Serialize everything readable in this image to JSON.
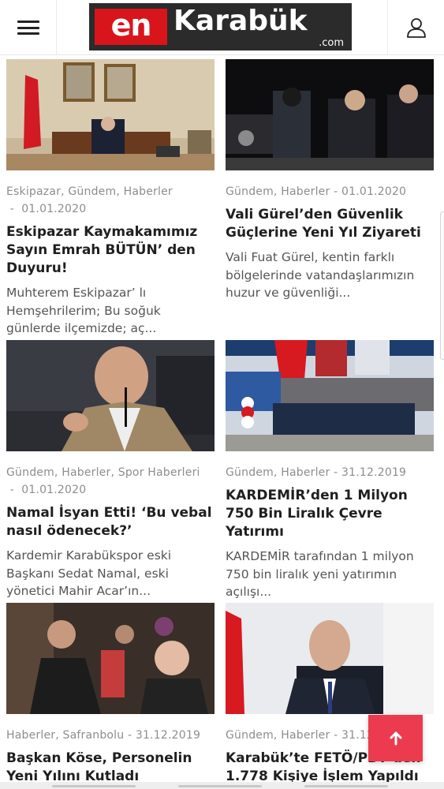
{
  "header": {
    "logo_en": "en",
    "logo_name": "Karabük",
    "logo_domain": ".com",
    "menu_icon": "hamburger-menu-icon",
    "user_icon": "user-account-icon"
  },
  "colors": {
    "brand_red": "#d8151b",
    "logo_bg": "#2b2b2b",
    "scroll_top_bg": "#ec3b4f"
  },
  "articles": [
    {
      "meta_line1": "Eskipazar, Gündem, Haberler",
      "meta_line2": " -  01.01.2020",
      "title": "Eskipazar Kaymakamımız Sayın Emrah BÜTÜN’ den Duyuru!",
      "excerpt": "Muhterem Eskipazar’ lı Hemşehrilerim;   Bu soğuk günlerde ilçemizde; aç..."
    },
    {
      "meta_line1": "Gündem, Haberler -  01.01.2020",
      "meta_line2": "",
      "title": "Vali Gürel’den Güvenlik Güçlerine Yeni Yıl Ziyareti",
      "excerpt": "Vali Fuat Gürel, kentin farklı bölgelerinde vatandaşlarımızın huzur ve güvenliği..."
    },
    {
      "meta_line1": "Gündem, Haberler, Spor Haberleri",
      "meta_line2": " -  01.01.2020",
      "title": "Namal İsyan Etti! ‘Bu vebal nasıl ödenecek?’",
      "excerpt": "Kardemir Karabükspor eski Başkanı Sedat Namal, eski yönetici Mahir Acar’ın..."
    },
    {
      "meta_line1": "Gündem, Haberler -  31.12.2019",
      "meta_line2": "",
      "title": "KARDEMİR’den 1 Milyon 750 Bin Liralık Çevre Yatırımı",
      "excerpt": "KARDEMİR tarafından 1 milyon 750 bin liralık yeni yatırımın açılışı..."
    },
    {
      "meta_line1": "Haberler, Safranbolu -  31.12.2019",
      "meta_line2": "",
      "title": "Başkan Köse, Personelin Yeni Yılını Kutladı",
      "excerpt": ""
    },
    {
      "meta_line1": "Gündem, Haberler -  31.12.2019",
      "meta_line2": "",
      "title": "Karabük’te FETÖ/PDY’den 1.778 Kişiye İşlem Yapıldı",
      "excerpt": ""
    }
  ],
  "scroll_top_icon": "arrow-up-icon"
}
